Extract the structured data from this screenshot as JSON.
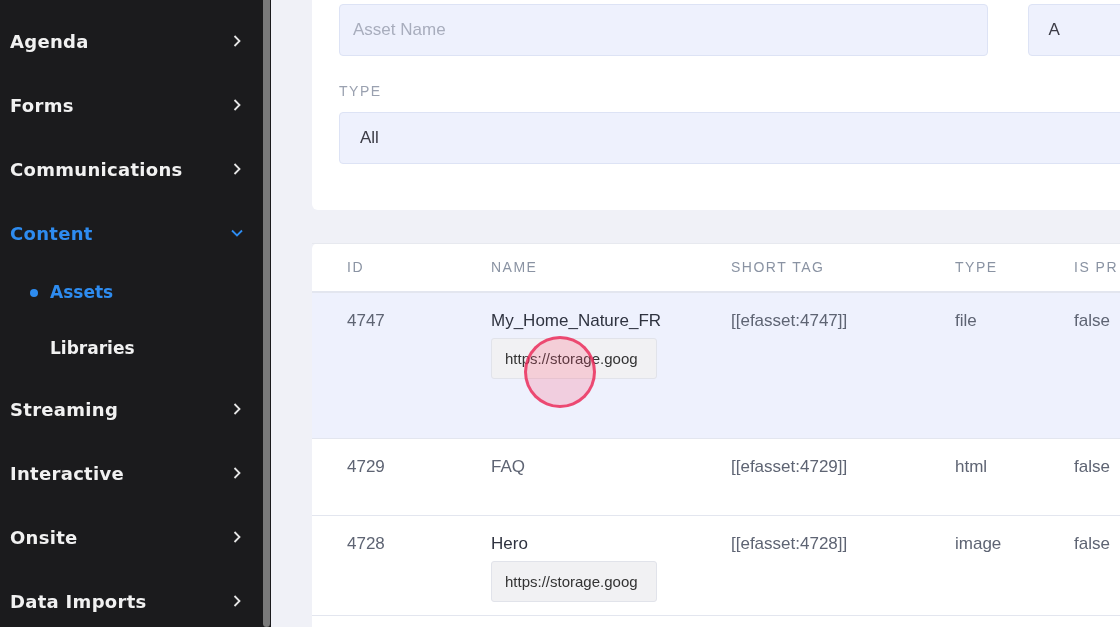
{
  "sidebar": {
    "items": [
      {
        "label": "Agenda",
        "expanded": false,
        "selected": false
      },
      {
        "label": "Forms",
        "expanded": false,
        "selected": false
      },
      {
        "label": "Communications",
        "expanded": false,
        "selected": false
      },
      {
        "label": "Content",
        "expanded": true,
        "selected": true,
        "children": [
          {
            "label": "Assets",
            "selected": true
          },
          {
            "label": "Libraries",
            "selected": false
          }
        ]
      },
      {
        "label": "Streaming",
        "expanded": false,
        "selected": false
      },
      {
        "label": "Interactive",
        "expanded": false,
        "selected": false
      },
      {
        "label": "Onsite",
        "expanded": false,
        "selected": false
      },
      {
        "label": "Data Imports",
        "expanded": false,
        "selected": false
      }
    ]
  },
  "filters": {
    "name_field": {
      "placeholder": "Asset Name"
    },
    "second_field": {
      "value": "A"
    },
    "type_label": "TYPE",
    "type_select": {
      "value": "All"
    }
  },
  "table": {
    "columns": [
      "ID",
      "NAME",
      "SHORT TAG",
      "TYPE",
      "IS PR"
    ],
    "rows": [
      {
        "id": "4747",
        "name": "My_Home_Nature_FR",
        "url": "https://storage.goog",
        "short_tag": "[[efasset:4747]]",
        "type": "file",
        "column_5": "false",
        "selected": true,
        "clicked": true
      },
      {
        "id": "4729",
        "name": "FAQ",
        "short_tag": "[[efasset:4729]]",
        "type": "html",
        "column_5": "false",
        "selected": false,
        "clicked": false
      },
      {
        "id": "4728",
        "name": "Hero",
        "url": "https://storage.goog",
        "short_tag": "[[efasset:4728]]",
        "type": "image",
        "column_5": "false",
        "selected": false,
        "clicked": false
      }
    ]
  }
}
